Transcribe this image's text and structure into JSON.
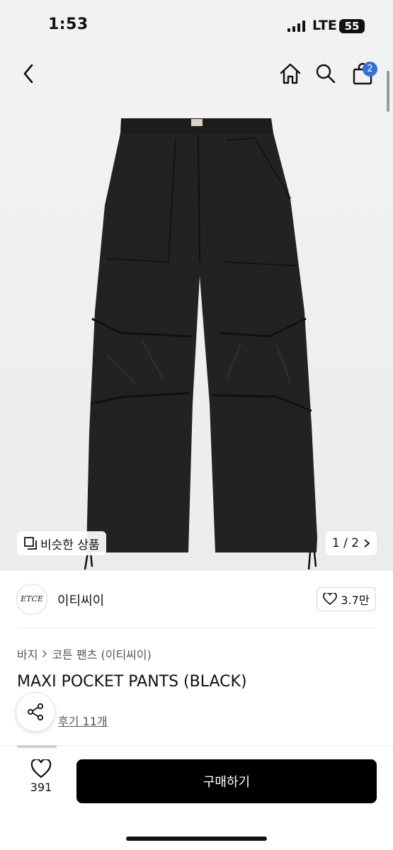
{
  "status_bar": {
    "time": "1:53",
    "network": "LTE",
    "battery": "55"
  },
  "header": {
    "cart_count": "2"
  },
  "hero": {
    "similar_label": "비슷한 상품",
    "page_indicator": "1 / 2",
    "image_alt": "black wide cargo pants"
  },
  "brand": {
    "logo_text": "ETCE",
    "name": "이티씨이",
    "likes": "3.7만"
  },
  "breadcrumb": {
    "level1": "바지",
    "level2": "코튼 팬츠 (이티씨이)"
  },
  "product": {
    "title": "MAXI POCKET PANTS (BLACK)",
    "reviews": "후기 11개"
  },
  "bottom_bar": {
    "wish_count": "391",
    "buy_label": "구매하기"
  },
  "colors": {
    "badge": "#2f6fe0",
    "buy_button": "#000000"
  }
}
